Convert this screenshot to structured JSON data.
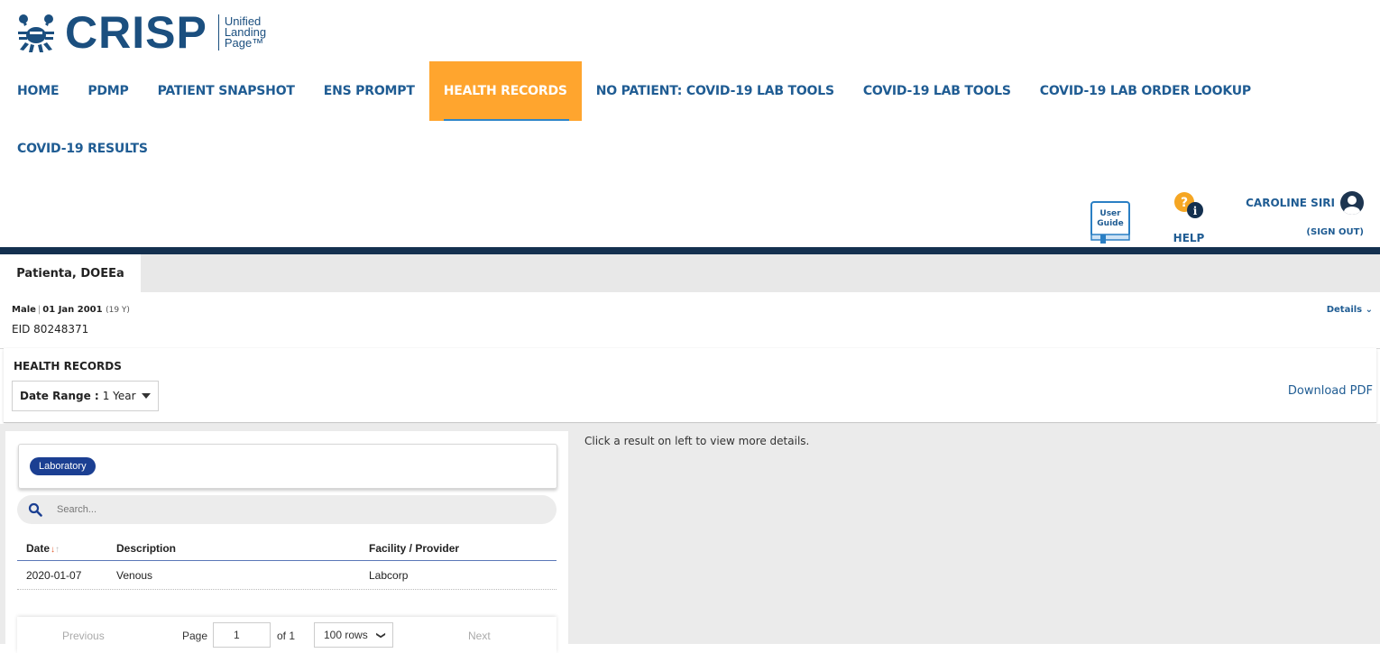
{
  "brand": {
    "name": "CRISP",
    "tagline_1": "Unified",
    "tagline_2": "Landing",
    "tagline_3": "Page™",
    "color": "#1b4f7f"
  },
  "nav": {
    "items": [
      {
        "label": "HOME"
      },
      {
        "label": "PDMP"
      },
      {
        "label": "PATIENT SNAPSHOT"
      },
      {
        "label": "ENS PROMPT"
      },
      {
        "label": "HEALTH RECORDS",
        "active": true
      },
      {
        "label": "NO PATIENT: COVID-19 LAB TOOLS"
      },
      {
        "label": "COVID-19 LAB TOOLS"
      },
      {
        "label": "COVID-19 LAB ORDER LOOKUP"
      }
    ],
    "row2": [
      {
        "label": "COVID-19 RESULTS"
      }
    ],
    "active_color": "#ffa52e"
  },
  "tools": {
    "guide_line1": "User",
    "guide_line2": "Guide",
    "help_label": "HELP",
    "user_name": "CAROLINE SIRI",
    "signout": "(SIGN OUT)"
  },
  "patient": {
    "tab_label": "Patienta, DOEEa",
    "sex": "Male",
    "dob": "01 Jan 2001",
    "age": "(19 Y)",
    "eid": "EID 80248371",
    "details_label": "Details"
  },
  "health_records": {
    "title": "HEALTH RECORDS",
    "date_range_label": "Date Range :",
    "date_range_value": "1 Year",
    "download_label": "Download PDF"
  },
  "filter": {
    "chip_label": "Laboratory",
    "chip_color": "#1b3f92"
  },
  "search": {
    "placeholder": "Search..."
  },
  "table": {
    "columns": [
      "Date",
      "Description",
      "Facility / Provider"
    ],
    "rows": [
      {
        "date": "2020-01-07",
        "description": "Venous",
        "facility": "Labcorp"
      }
    ]
  },
  "pager": {
    "previous": "Previous",
    "page_label": "Page",
    "page_value": "1",
    "of_label": "of 1",
    "rows_value": "100 rows",
    "next": "Next"
  },
  "detail_message": "Click a result on left to view more details."
}
